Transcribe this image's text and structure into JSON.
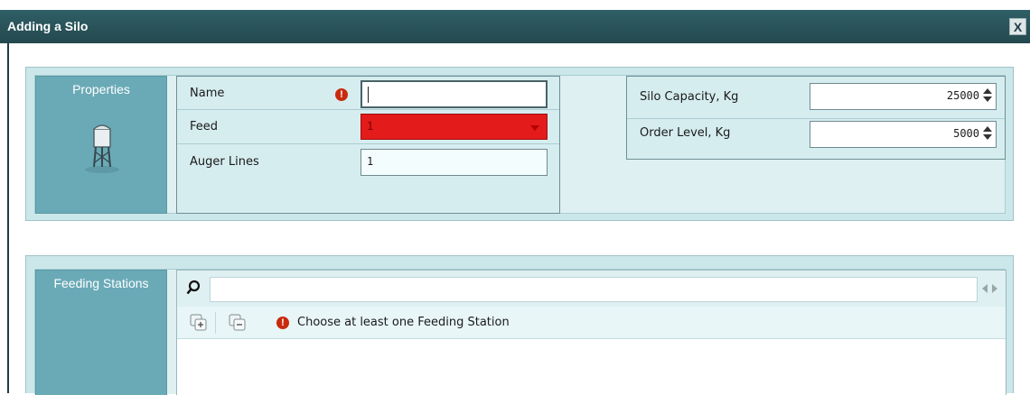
{
  "window": {
    "title": "Adding a Silo",
    "close_label": "X"
  },
  "properties": {
    "section_label": "Properties",
    "icon": "silo-icon",
    "name": {
      "label": "Name",
      "value": "",
      "error_mark": "!"
    },
    "feed": {
      "label": "Feed",
      "value": "1",
      "error_color": "#e31b1b"
    },
    "auger_lines": {
      "label": "Auger Lines",
      "value": "1"
    },
    "silo_capacity": {
      "label": "Silo Capacity, Kg",
      "value": "25000"
    },
    "order_level": {
      "label": "Order Level, Kg",
      "value": "5000"
    }
  },
  "feeding_stations": {
    "section_label": "Feeding Stations",
    "search": {
      "placeholder": "",
      "value": ""
    },
    "warning": "Choose at least one Feeding Station",
    "error_mark": "!",
    "icons": [
      "expand-all-icon",
      "collapse-all-icon"
    ]
  },
  "colors": {
    "titlebar": "#2a545a",
    "accent": "#6aaab7",
    "error": "#c92a0d"
  }
}
